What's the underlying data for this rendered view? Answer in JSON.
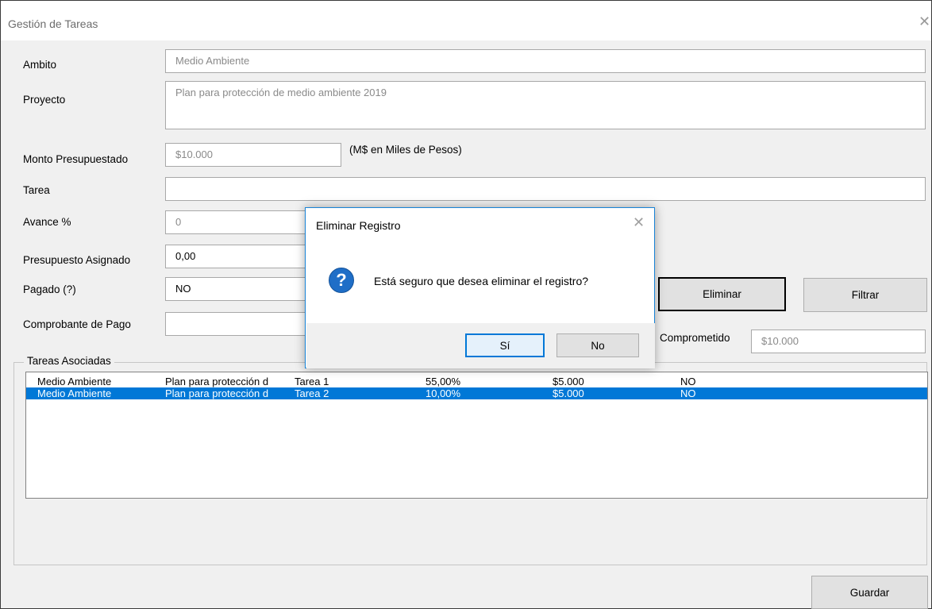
{
  "window": {
    "title": "Gestión de Tareas",
    "close_glyph": "✕"
  },
  "form": {
    "ambito": {
      "label": "Ambito",
      "value": "Medio Ambiente"
    },
    "proyecto": {
      "label": "Proyecto",
      "value": "Plan para protección de medio ambiente 2019"
    },
    "monto": {
      "label": "Monto Presupuestado",
      "value": "$10.000",
      "note": "(M$ en Miles de Pesos)"
    },
    "tarea": {
      "label": "Tarea",
      "value": ""
    },
    "avance": {
      "label": "Avance %",
      "value": "0"
    },
    "presupuesto": {
      "label": "Presupuesto Asignado",
      "value": "0,00"
    },
    "pagado": {
      "label": "Pagado (?)",
      "value": "NO"
    },
    "comprobante": {
      "label": "Comprobante de Pago",
      "value": ""
    },
    "comprometido": {
      "label": "Comprometido",
      "value": "$10.000"
    }
  },
  "buttons": {
    "eliminar": "Eliminar",
    "filtrar": "Filtrar",
    "guardar": "Guardar"
  },
  "tareas": {
    "group_title": "Tareas Asociadas",
    "rows": [
      [
        "Medio Ambiente",
        "Plan para protección d",
        "Tarea 1",
        "55,00%",
        "$5.000",
        "NO"
      ],
      [
        "Medio Ambiente",
        "Plan para protección d",
        "Tarea 2",
        "10,00%",
        "$5.000",
        "NO"
      ]
    ],
    "selected_index": 1
  },
  "dialog": {
    "title": "Eliminar Registro",
    "message": "Está seguro que desea eliminar el registro?",
    "icon": "question-icon",
    "icon_glyph": "?",
    "close_glyph": "✕",
    "yes": "Sí",
    "no": "No"
  },
  "colors": {
    "selection": "#0078d7",
    "dialog_border": "#1883d7",
    "icon": "#1f6ec7"
  }
}
